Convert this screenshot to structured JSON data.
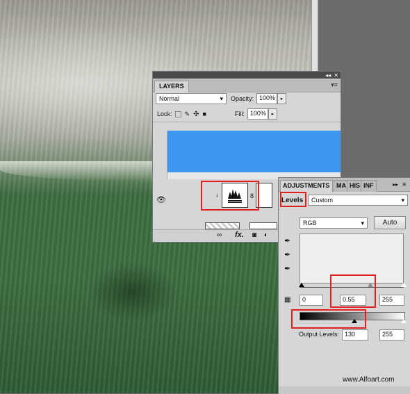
{
  "layers_panel": {
    "tab_label": "LAYERS",
    "blend_mode": "Normal",
    "opacity_label": "Opacity:",
    "opacity_value": "100%",
    "lock_label": "Lock:",
    "fill_label": "Fill:",
    "fill_value": "100%"
  },
  "adjustments_panel": {
    "tabs": [
      "ADJUSTMENTS",
      "MA",
      "HIS",
      "INF"
    ],
    "adjustment_type": "Levels",
    "preset": "Custom",
    "channel": "RGB",
    "auto_label": "Auto",
    "input_levels": {
      "black": "0",
      "gamma": "0.55",
      "white": "255"
    },
    "output_label": "Output Levels:",
    "output_levels": {
      "black": "130",
      "white": "255"
    }
  },
  "watermark": "www.Alfoart.com",
  "colors": {
    "selection_blue": "#3d97f0",
    "highlight_red": "#e02020"
  }
}
